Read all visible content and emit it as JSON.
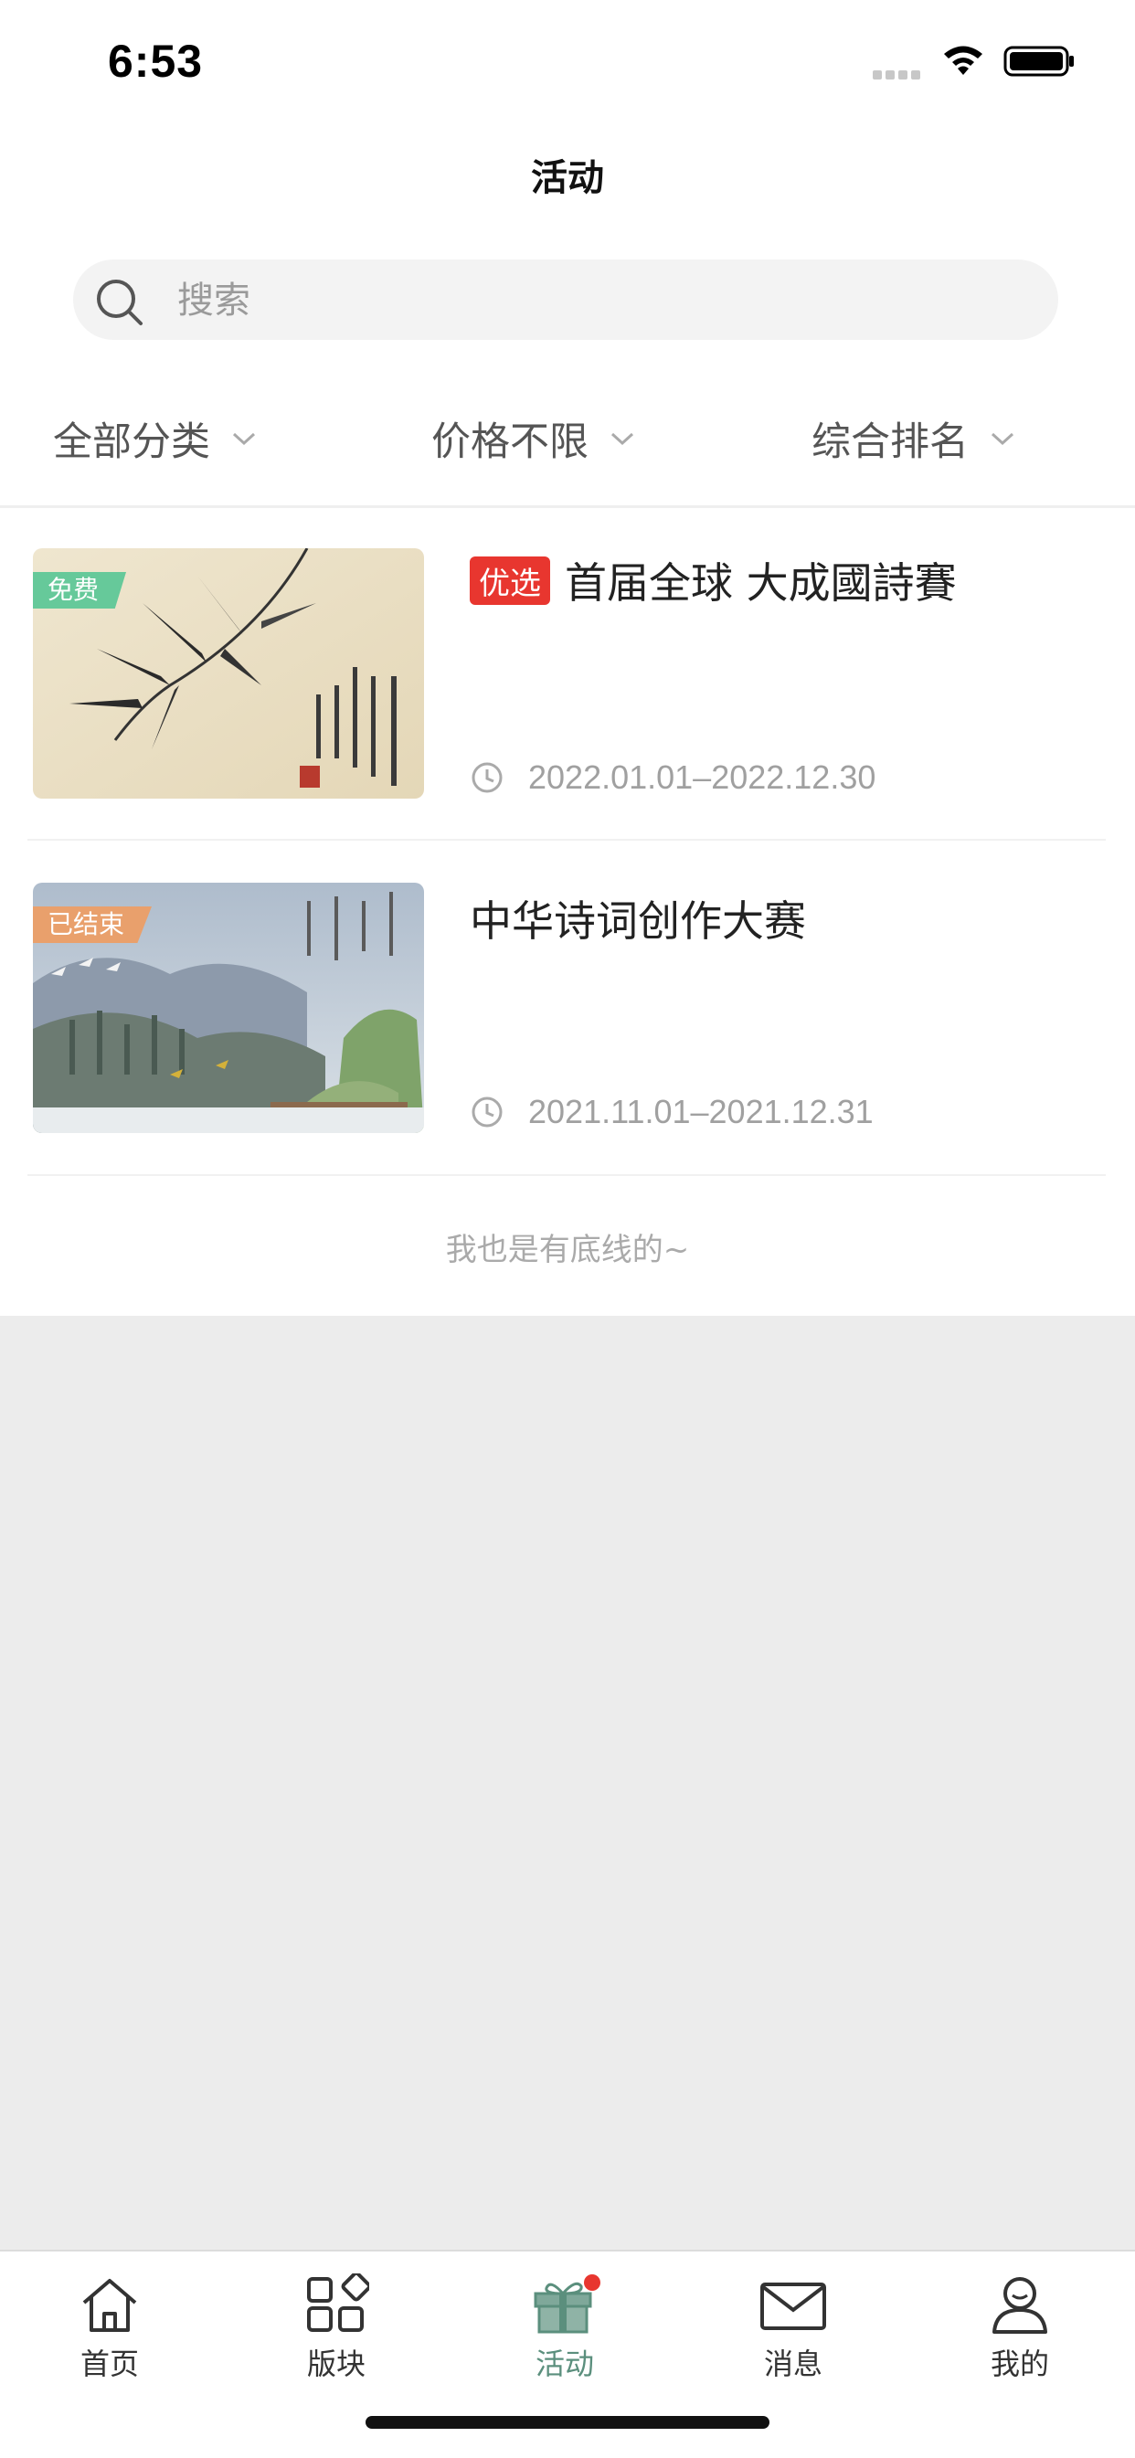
{
  "status_bar": {
    "time": "6:53"
  },
  "header": {
    "title": "活动"
  },
  "search": {
    "placeholder": "搜索"
  },
  "filters": [
    {
      "label": "全部分类"
    },
    {
      "label": "价格不限"
    },
    {
      "label": "综合排名"
    }
  ],
  "activities": [
    {
      "tag": "免费",
      "tag_color": "#66c99a",
      "badge": "优选",
      "title": "首届全球 大成國詩賽",
      "date": "2022.01.01–2022.12.30"
    },
    {
      "tag": "已结束",
      "tag_color": "#e9a06c",
      "title": "中华诗词创作大赛",
      "date": "2021.11.01–2021.12.31"
    }
  ],
  "list_footer": "我也是有底线的~",
  "tabbar": {
    "items": [
      {
        "label": "首页",
        "icon": "home-icon"
      },
      {
        "label": "版块",
        "icon": "grid-icon"
      },
      {
        "label": "活动",
        "icon": "gift-icon",
        "active": true,
        "has_dot": true
      },
      {
        "label": "消息",
        "icon": "mail-icon"
      },
      {
        "label": "我的",
        "icon": "user-icon"
      }
    ],
    "active_color": "#5b8f7d",
    "dot_color": "#e8362f"
  }
}
